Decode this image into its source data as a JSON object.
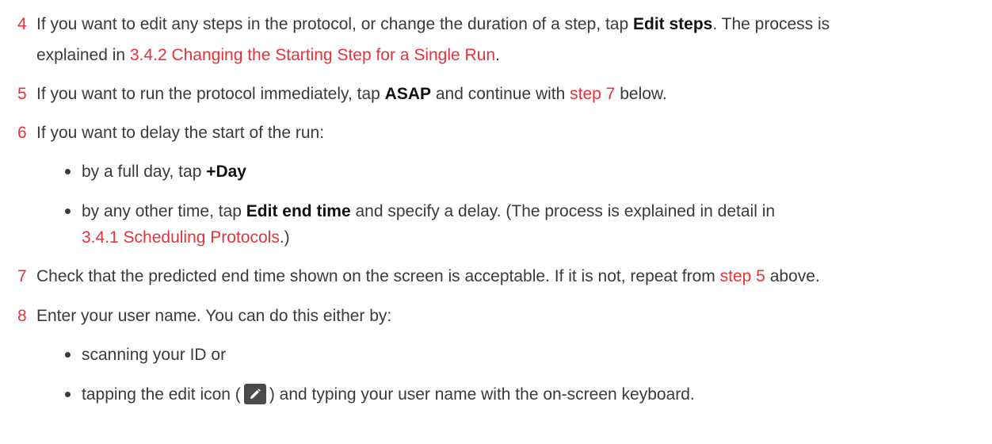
{
  "steps": [
    {
      "num": "4",
      "line1_a": "If you want to edit any steps in the protocol, or change the duration of a step, tap ",
      "line1_bold": "Edit steps",
      "line1_b": ". The process is",
      "line2_a": "explained in ",
      "line2_link": "3.4.2 Changing the Starting Step for a Single Run",
      "line2_b": "."
    },
    {
      "num": "5",
      "a": "If you want to run the protocol immediately, tap ",
      "bold": "ASAP",
      "b": " and continue with ",
      "link": "step 7",
      "c": " below."
    },
    {
      "num": "6",
      "text": "If you want to delay the start of the run:",
      "bullets": [
        {
          "a": "by a full day, tap ",
          "bold": "+Day"
        },
        {
          "a": "by any other time, tap ",
          "bold": "Edit end time",
          "b": " and specify a delay. (The process is explained in detail in",
          "link": "3.4.1 Scheduling Protocols",
          "c": ".)"
        }
      ]
    },
    {
      "num": "7",
      "a": "Check that the predicted end time shown on the screen is acceptable. If it is not, repeat from ",
      "link": "step 5",
      "b": " above."
    },
    {
      "num": "8",
      "text": "Enter your user name. You can do this either by:",
      "bullets": [
        {
          "a": "scanning your ID or"
        },
        {
          "a": "tapping the edit icon (",
          "icon": "edit-pencil-icon",
          "b": ") and typing your user name with the on-screen keyboard."
        }
      ]
    }
  ]
}
